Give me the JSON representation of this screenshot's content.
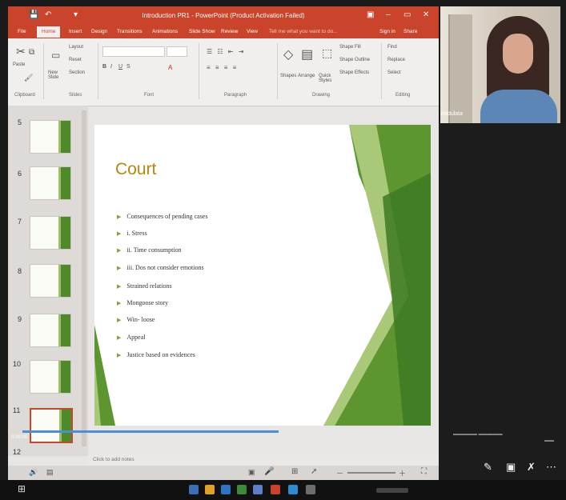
{
  "window": {
    "title": "Introduction PR1 - PowerPoint (Product Activation Failed)",
    "controls": [
      "▣",
      "–",
      "▭",
      "✕"
    ]
  },
  "tabs": [
    "File",
    "Home",
    "Insert",
    "Design",
    "Transitions",
    "Animations",
    "Slide Show",
    "Review",
    "View",
    "Tell me what you want to do..."
  ],
  "tab_right": [
    "Sign in",
    "Share"
  ],
  "ribbon": {
    "paste": "Paste",
    "layout": "Layout",
    "reset": "Reset",
    "new_slide": "New Slide",
    "section": "Section",
    "groups": [
      "Clipboard",
      "Slides",
      "Font",
      "Paragraph",
      "Drawing",
      "Editing"
    ],
    "shape_fill": "Shape Fill",
    "shape_outline": "Shape Outline",
    "shape_effects": "Shape Effects",
    "shapes": "Shapes",
    "arrange": "Arrange",
    "quick_styles": "Quick Styles",
    "find": "Find",
    "replace": "Replace",
    "select": "Select"
  },
  "thumbnails": {
    "numbers": [
      "5",
      "6",
      "7",
      "8",
      "9",
      "10",
      "11",
      "12"
    ],
    "selected": "11"
  },
  "slide": {
    "title": "Court",
    "bullets": [
      "Consequences of pending cases",
      "i. Stress",
      "ii. Time consumption",
      "iii. Dos not consider emotions",
      "Strained relations",
      "Mongoose story",
      "Win- loose",
      "Appeal",
      "Justice based on evidences"
    ]
  },
  "notes_placeholder": "Click to add notes",
  "video": {
    "elapsed": "0:36:05"
  },
  "participant": {
    "name": "viddulata"
  },
  "colors": {
    "accent": "#c9442a",
    "slide_title": "#b8860b",
    "green_dark": "#4f8a2a",
    "green_light": "#9dbf68"
  }
}
